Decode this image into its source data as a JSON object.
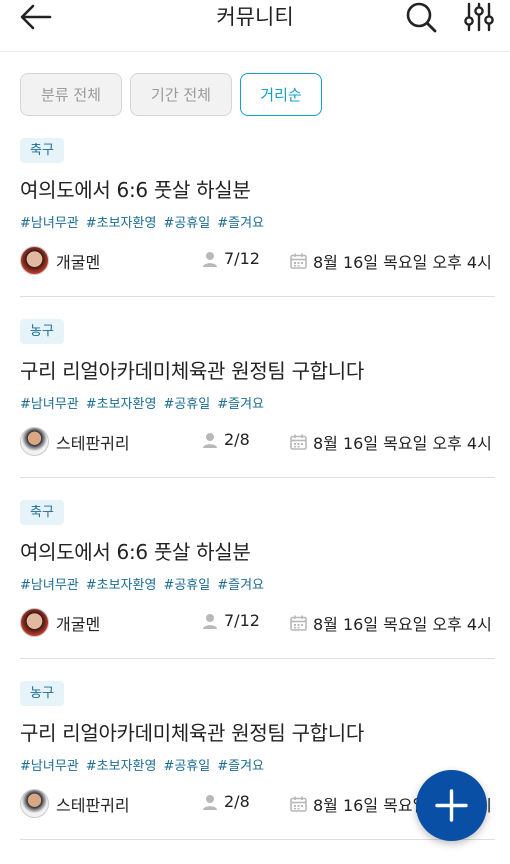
{
  "header": {
    "title": "커뮤니티",
    "icons": {
      "back": "back-arrow-icon",
      "search": "search-icon",
      "filter": "filter-sliders-icon"
    }
  },
  "filters": [
    {
      "label": "분류 전체",
      "active": false
    },
    {
      "label": "기간 전체",
      "active": false
    },
    {
      "label": "거리순",
      "active": true
    }
  ],
  "posts": [
    {
      "category": "축구",
      "title": "여의도에서 6:6 풋살 하실분",
      "tags": [
        "#남녀무관",
        "#초보자환영",
        "#공휴일",
        "#즐겨요"
      ],
      "author": "개굴멘",
      "count": "7/12",
      "datetime": "8월 16일 목요일 오후 4시"
    },
    {
      "category": "농구",
      "title": "구리 리얼아카데미체육관 원정팀 구합니다",
      "tags": [
        "#남녀무관",
        "#초보자환영",
        "#공휴일",
        "#즐겨요"
      ],
      "author": "스테판귀리",
      "count": "2/8",
      "datetime": "8월 16일 목요일 오후 4시"
    },
    {
      "category": "축구",
      "title": "여의도에서 6:6 풋살 하실분",
      "tags": [
        "#남녀무관",
        "#초보자환영",
        "#공휴일",
        "#즐겨요"
      ],
      "author": "개굴멘",
      "count": "7/12",
      "datetime": "8월 16일 목요일 오후 4시"
    },
    {
      "category": "농구",
      "title": "구리 리얼아카데미체육관 원정팀 구합니다",
      "tags": [
        "#남녀무관",
        "#초보자환영",
        "#공휴일",
        "#즐겨요"
      ],
      "author": "스테판귀리",
      "count": "2/8",
      "datetime": "8월 16일 목요일 오후 4시"
    }
  ],
  "fab": {
    "icon": "plus-icon"
  },
  "colors": {
    "accent": "#14a0c9",
    "tag": "#1b6c94",
    "badge_bg": "#e6f4fa",
    "fab": "#0a4fa6"
  }
}
